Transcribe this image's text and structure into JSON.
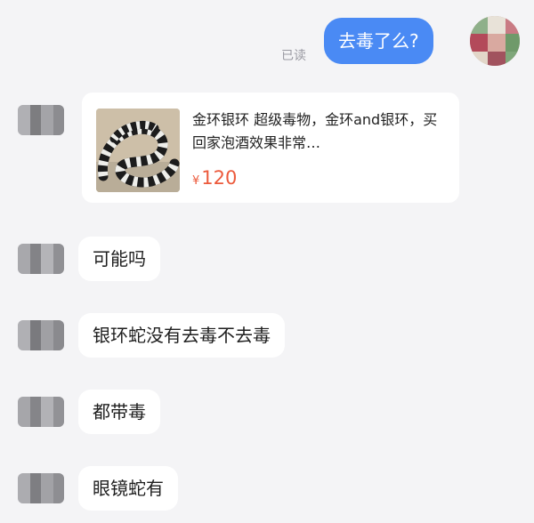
{
  "messages": {
    "outgoing": {
      "text": "去毒了么?",
      "read_status": "已读"
    },
    "product_card": {
      "title": "金环银环 超级毒物，金环and银环，买回家泡酒效果非常…",
      "currency": "¥",
      "price": "120",
      "image_icon": "banded-snake-image"
    },
    "incoming": [
      {
        "text": "可能吗"
      },
      {
        "text": "银环蛇没有去毒不去毒"
      },
      {
        "text": "都带毒"
      },
      {
        "text": "眼镜蛇有"
      }
    ]
  },
  "colors": {
    "background": "#f4f4f6",
    "outgoing_bubble": "#4a8af4",
    "incoming_bubble": "#ffffff",
    "price": "#ec5a3c",
    "read_label": "#9a9aa2"
  },
  "icons": {
    "self_avatar": "pixelated-avatar-icon",
    "contact_avatar": "pixelated-avatar-icon"
  }
}
